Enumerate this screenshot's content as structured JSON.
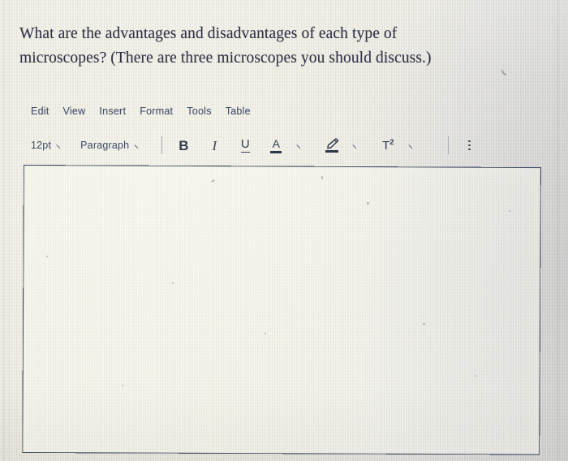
{
  "question": {
    "line1": "What are the advantages and disadvantages of each type of",
    "line2": "microscopes? (There are three microscopes you should discuss.)"
  },
  "menubar": {
    "items": [
      {
        "label": "Edit"
      },
      {
        "label": "View"
      },
      {
        "label": "Insert"
      },
      {
        "label": "Format"
      },
      {
        "label": "Tools"
      },
      {
        "label": "Table"
      }
    ]
  },
  "toolbar": {
    "fontsize": {
      "value": "12pt",
      "icon": "chevron-down-icon"
    },
    "blockformat": {
      "value": "Paragraph",
      "icon": "chevron-down-icon"
    },
    "bold": {
      "label": "B",
      "icon": "bold-icon"
    },
    "italic": {
      "label": "I",
      "icon": "italic-icon"
    },
    "underline": {
      "label": "U",
      "icon": "underline-icon"
    },
    "textcolor": {
      "label": "A",
      "icon": "text-color-icon"
    },
    "highlight": {
      "label": "",
      "icon": "highlight-pen-icon"
    },
    "superscript": {
      "base": "T",
      "exponent": "2",
      "icon": "superscript-icon"
    },
    "more": {
      "icon": "kebab-menu-icon"
    }
  },
  "editor": {
    "content": "",
    "placeholder": ""
  },
  "colors": {
    "background": "#eceadf",
    "question_text": "#2f3247",
    "menu_text": "#44506b",
    "toolbar_text": "#3e4a63",
    "editor_border": "#404a63",
    "editor_background": "#fcfbf3"
  }
}
